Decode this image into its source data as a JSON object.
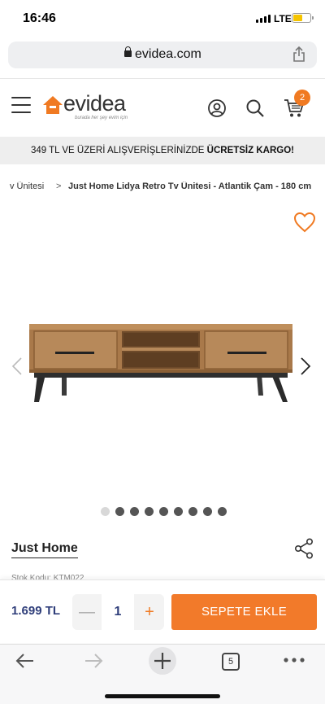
{
  "status": {
    "time": "16:46",
    "network": "LTE",
    "battery_level": 0.55
  },
  "browser": {
    "url": "evidea.com",
    "tab_count": "5"
  },
  "header": {
    "logo_text": "evidea",
    "logo_tagline": "burada her şey evim için",
    "cart_count": "2"
  },
  "promo": {
    "text": "349 TL VE ÜZERİ ALIŞVERİŞLERİNİZDE ",
    "highlight": "ÜCRETSİZ KARGO!"
  },
  "breadcrumb": {
    "parent": "v Ünitesi",
    "separator": ">",
    "current": "Just Home Lidya Retro Tv Ünitesi - Atlantik Çam - 180 cm"
  },
  "gallery": {
    "image_count": 9,
    "active_index": 0
  },
  "product": {
    "brand": "Just Home",
    "stock_code": "Stok Kodu: KTM022",
    "price": "1.699 TL",
    "quantity": "1"
  },
  "buttons": {
    "add_to_cart": "SEPETE EKLE",
    "minus": "—",
    "plus": "+"
  },
  "colors": {
    "accent": "#f27a2a",
    "price_text": "#2f3e7a",
    "promo_bg": "#eeeeee"
  },
  "icons": [
    "lock-icon",
    "share-icon",
    "hamburger-icon",
    "user-icon",
    "search-icon",
    "cart-icon",
    "heart-icon",
    "chevron-left-icon",
    "chevron-right-icon",
    "share-nodes-icon",
    "back-icon",
    "forward-icon",
    "new-tab-icon",
    "tabs-icon",
    "more-icon"
  ]
}
